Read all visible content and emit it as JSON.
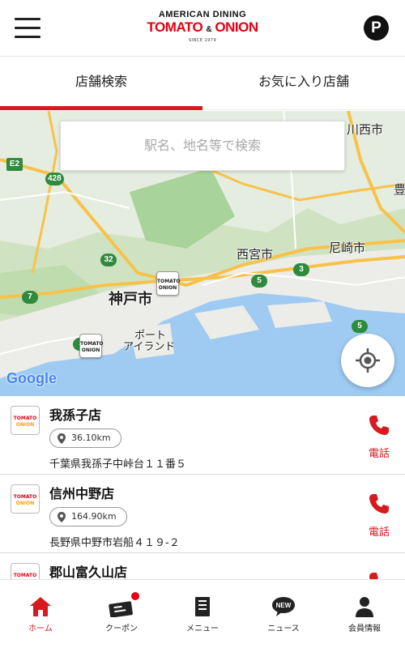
{
  "header": {
    "logo_top": "AMERICAN DINING",
    "logo_word1": "TOMATO",
    "logo_amp": "&",
    "logo_word2": "ONION",
    "logo_since": "SINCE 1979",
    "points_label": "P"
  },
  "tabs": [
    {
      "label": "店舗検索",
      "active": true
    },
    {
      "label": "お気に入り店舗",
      "active": false
    }
  ],
  "map": {
    "search_placeholder": "駅名、地名等で検索",
    "labels": {
      "kobe": "神戸市",
      "nishinomiya": "西宮市",
      "amagasaki": "尼崎市",
      "port_island_1": "ポート",
      "port_island_2": "アイランド",
      "kawanishi": "川西市",
      "toyo": "豊"
    },
    "road_badges": [
      "E2",
      "428",
      "32",
      "7",
      "3",
      "5",
      "5",
      "3"
    ],
    "pin_text": "TOMATO ONION",
    "attribution": "Google"
  },
  "stores": [
    {
      "name": "我孫子店",
      "distance": "36.10km",
      "address": "千葉県我孫子中峠台１１番５",
      "call_label": "電話"
    },
    {
      "name": "信州中野店",
      "distance": "164.90km",
      "address": "長野県中野市岩船４１９-２",
      "call_label": "電話"
    },
    {
      "name": "郡山富久山店",
      "distance": "",
      "address": "",
      "call_label": ""
    }
  ],
  "store_logo_text": {
    "line1": "TOMATO",
    "line2": "ONION"
  },
  "bottom_nav": [
    {
      "label": "ホーム",
      "icon": "home-icon",
      "active": true
    },
    {
      "label": "クーポン",
      "icon": "coupon-icon",
      "active": false,
      "badge": true
    },
    {
      "label": "メニュー",
      "icon": "menu-book-icon",
      "active": false
    },
    {
      "label": "ニュース",
      "icon": "news-icon",
      "active": false
    },
    {
      "label": "会員情報",
      "icon": "member-icon",
      "active": false
    }
  ],
  "colors": {
    "accent": "#d61a1f",
    "road_green": "#2e8b3e"
  }
}
